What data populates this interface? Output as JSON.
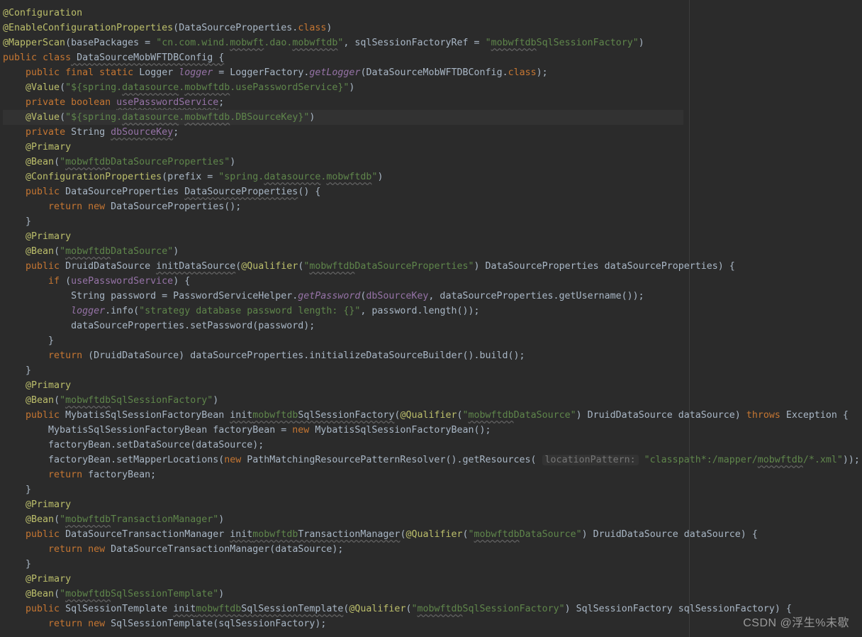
{
  "watermark": "CSDN @浮生%未歇",
  "code": {
    "ln1": {
      "a": "@Configuration"
    },
    "ln2": {
      "a": "@EnableConfigurationProperties",
      "b": "(",
      "c": "DataSourceProperties",
      "d": ".",
      "e": "class",
      "f": ")"
    },
    "ln3": {
      "a": "@MapperScan",
      "b": "(",
      "c": "basePackages",
      "d": " = ",
      "e": "\"cn.com.wind.",
      "f": "mobwft",
      "g": ".dao.",
      "h": "mobwftdb",
      "i": "\"",
      "j": ", ",
      "k": "sqlSessionFactoryRef",
      "l": " = ",
      "m": "\"",
      "n": "mobwftdb",
      "o": "SqlSessionFactory\"",
      "p": ")"
    },
    "ln4": {
      "a": "public",
      "b": " ",
      "c": "class",
      "d": " DataSourceMobWFTDBConfig {"
    },
    "ln5": {
      "a": "    ",
      "b": "public",
      "c": " ",
      "d": "final",
      "e": " ",
      "f": "static",
      "g": " Logger ",
      "h": "logger",
      "i": " = LoggerFactory.",
      "j": "getLogger",
      "k": "(DataSourceMobWFTDBConfig.",
      "l": "class",
      "m": ");"
    },
    "ln6": {
      "a": "    ",
      "b": "@Value",
      "c": "(",
      "d": "\"${spring.",
      "e": "datasource",
      "f": ".",
      "g": "mobwftdb",
      "h": ".usePasswordService}\"",
      "i": ")"
    },
    "ln7": {
      "a": "    ",
      "b": "private",
      "c": " ",
      "d": "boolean",
      "e": " ",
      "f": "usePasswordService",
      "g": ";"
    },
    "ln8": {
      "a": "    ",
      "b": "@Value",
      "c": "(",
      "d": "\"${spring.",
      "e": "datasource",
      "f": ".",
      "g": "mobwftdb",
      "h": ".DBSourceKey}\"",
      "i": ")"
    },
    "ln9": {
      "a": "    ",
      "b": "private",
      "c": " String ",
      "d": "dbSourceKey",
      "e": ";"
    },
    "ln10": {
      "a": "    ",
      "b": "@Primary"
    },
    "ln11": {
      "a": "    ",
      "b": "@Bean",
      "c": "(",
      "d": "\"",
      "e": "mobwftdb",
      "f": "DataSourceProperties\"",
      "g": ")"
    },
    "ln12": {
      "a": "    ",
      "b": "@ConfigurationProperties",
      "c": "(",
      "d": "prefix",
      "e": " = ",
      "f": "\"spring.",
      "g": "datasource",
      "h": ".",
      "i": "mobwftdb",
      "j": "\"",
      "k": ")"
    },
    "ln13": {
      "a": "    ",
      "b": "public",
      "c": " DataSourceProperties ",
      "d": "DataSourceProperties",
      "e": "() {"
    },
    "ln14": {
      "a": "        ",
      "b": "return",
      "c": " ",
      "d": "new",
      "e": " DataSourceProperties();"
    },
    "ln15": {
      "a": "    }"
    },
    "ln16": {
      "a": "    ",
      "b": "@Primary"
    },
    "ln17": {
      "a": "    ",
      "b": "@Bean",
      "c": "(",
      "d": "\"",
      "e": "mobwftdb",
      "f": "DataSource\"",
      "g": ")"
    },
    "ln18": {
      "a": "    ",
      "b": "public",
      "c": " DruidDataSource ",
      "d": "initDataSource",
      "e": "(",
      "f": "@Qualifier",
      "g": "(",
      "h": "\"",
      "i": "mobwftdb",
      "j": "DataSourceProperties\"",
      "k": ") DataSourceProperties dataSourceProperties) {"
    },
    "ln19": {
      "a": "        ",
      "b": "if",
      "c": " (",
      "d": "usePasswordService",
      "e": ") {"
    },
    "ln20": {
      "a": "            String password = PasswordServiceHelper.",
      "b": "getPassword",
      "c": "(",
      "d": "dbSourceKey",
      "e": ", dataSourceProperties.getUsername());"
    },
    "ln21": {
      "a": "            ",
      "b": "logger",
      "c": ".info(",
      "d": "\"strategy database password length: {}\"",
      "e": ", password.length());"
    },
    "ln22": {
      "a": "            dataSourceProperties.setPassword(password);"
    },
    "ln23": {
      "a": "        }"
    },
    "ln24": {
      "a": "        ",
      "b": "return",
      "c": " (DruidDataSource) dataSourceProperties.initializeDataSourceBuilder().build();"
    },
    "ln25": {
      "a": "    }"
    },
    "ln26": {
      "a": "    ",
      "b": "@Primary"
    },
    "ln27": {
      "a": "    ",
      "b": "@Bean",
      "c": "(",
      "d": "\"",
      "e": "mobwftdb",
      "f": "SqlSessionFactory\"",
      "g": ")"
    },
    "ln28": {
      "a": "    ",
      "b": "public",
      "c": " MybatisSqlSessionFactoryBean ",
      "d": "init",
      "e": "mobwftdb",
      "f": "SqlSessionFactory",
      "g": "(",
      "h": "@Qualifier",
      "i": "(",
      "j": "\"",
      "k": "mobwftdb",
      "l": "DataSource\"",
      "m": ") DruidDataSource dataSource) ",
      "n": "throws",
      "o": " Exception {"
    },
    "ln29": {
      "a": "        MybatisSqlSessionFactoryBean factoryBean = ",
      "b": "new",
      "c": " MybatisSqlSessionFactoryBean();"
    },
    "ln30": {
      "a": "        factoryBean.setDataSource(dataSource);"
    },
    "ln31": {
      "a": "        factoryBean.setMapperLocations(",
      "b": "new",
      "c": " PathMatchingResourcePatternResolver().getResources( ",
      "d": "locationPattern:",
      "e": " ",
      "f": "\"classpath*:/mapper/",
      "g": "mobwftdb",
      "h": "/*.xml\"",
      "i": "));"
    },
    "ln32": {
      "a": "        ",
      "b": "return",
      "c": " factoryBean;"
    },
    "ln33": {
      "a": "    }"
    },
    "ln34": {
      "a": "    ",
      "b": "@Primary"
    },
    "ln35": {
      "a": "    ",
      "b": "@Bean",
      "c": "(",
      "d": "\"",
      "e": "mobwftdb",
      "f": "TransactionManager\"",
      "g": ")"
    },
    "ln36": {
      "a": "    ",
      "b": "public",
      "c": " DataSourceTransactionManager ",
      "d": "init",
      "e": "mobwftdb",
      "f": "TransactionManager",
      "g": "(",
      "h": "@Qualifier",
      "i": "(",
      "j": "\"",
      "k": "mobwftdb",
      "l": "DataSource\"",
      "m": ") DruidDataSource dataSource) {"
    },
    "ln37": {
      "a": "        ",
      "b": "return",
      "c": " ",
      "d": "new",
      "e": " DataSourceTransactionManager(dataSource);"
    },
    "ln38": {
      "a": "    }"
    },
    "ln39": {
      "a": "    ",
      "b": "@Primary"
    },
    "ln40": {
      "a": "    ",
      "b": "@Bean",
      "c": "(",
      "d": "\"",
      "e": "mobwftdb",
      "f": "SqlSessionTemplate\"",
      "g": ")"
    },
    "ln41": {
      "a": "    ",
      "b": "public",
      "c": " SqlSessionTemplate ",
      "d": "init",
      "e": "mobwftdb",
      "f": "SqlSessionTemplate",
      "g": "(",
      "h": "@Qualifier",
      "i": "(",
      "j": "\"",
      "k": "mobwftdb",
      "l": "SqlSessionFactory\"",
      "m": ") SqlSessionFactory sqlSessionFactory) {"
    },
    "ln42": {
      "a": "        ",
      "b": "return",
      "c": " ",
      "d": "new",
      "e": " SqlSessionTemplate(sqlSessionFactory);"
    }
  }
}
